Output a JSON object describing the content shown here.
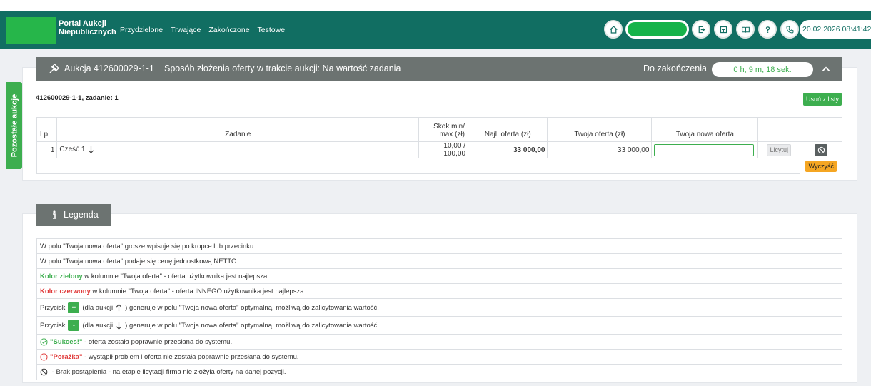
{
  "header": {
    "brand_line1": "Portal Aukcji",
    "brand_line2": "Niepublicznych",
    "nav": [
      "Przydzielone",
      "Trwające",
      "Zakończone",
      "Testowe"
    ],
    "datetime": "20.02.2026 08:41:42",
    "icons": [
      "home-icon",
      "logout-icon",
      "calculator-icon",
      "book-icon",
      "help-icon",
      "phone-icon"
    ]
  },
  "side_tab": {
    "label": "Pozostałe aukcje"
  },
  "auction": {
    "title": "Aukcja 412600029-1-1",
    "mode": "Sposób złożenia oferty w trakcie aukcji: Na wartość zadania",
    "remaining_label": "Do zakończenia",
    "timer": "0 h, 9 m, 18 sek.",
    "subtitle": "412600029-1-1, zadanie: 1",
    "remove_label": "Usuń z listy",
    "columns": {
      "lp": "Lp.",
      "task": "Zadanie",
      "step_line1": "Skok min/",
      "step_line2": "max (zł)",
      "best": "Najl. oferta (zł)",
      "yours": "Twoja oferta (zł)",
      "new": "Twoja nowa oferta"
    },
    "row": {
      "lp": "1",
      "task": "Cześć 1",
      "step": "10,00 / 100,00",
      "best": "33 000,00",
      "yours": "33 000,00",
      "minus": "-",
      "bid_label": "Licytuj"
    },
    "clear_label": "Wyczyść"
  },
  "legend": {
    "title": "Legenda",
    "rows": {
      "r1": "W polu \"Twoja nowa oferta\" grosze wpisuje się po kropce lub przecinku.",
      "r2": "W polu \"Twoja nowa oferta\" podaje się cenę jednostkową NETTO .",
      "r3_bold": "Kolor zielony",
      "r3_rest": " w kolumnie \"Twoja oferta\" - oferta użytkownika jest najlepsza.",
      "r4_bold": "Kolor czerwony",
      "r4_rest": " w kolumnie \"Twoja oferta\" - oferta INNEGO użytkownika jest najlepsza.",
      "r5_prefix": "Przycisk",
      "r5_btn": "+",
      "r5_mid": "(dla aukcji",
      "r5_rest": ") generuje w polu \"Twoja nowa oferta\" optymalną, możliwą do zalicytowania wartość.",
      "r6_prefix": "Przycisk",
      "r6_btn": "-",
      "r6_mid": "(dla aukcji",
      "r6_rest": ") generuje w polu \"Twoja nowa oferta\" optymalną, możliwą do zalicytowania wartość.",
      "r7_bold": "\"Sukces!\"",
      "r7_rest": " - oferta została poprawnie przesłana do systemu.",
      "r8_bold": "\"Porażka\"",
      "r8_rest": " - wystąpił problem i oferta nie została poprawnie przesłana do systemu.",
      "r9_rest": " - Brak postąpienia - na etapie licytacji firma nie złożyła oferty na danej pozycji."
    }
  },
  "colors": {
    "header_bg": "#116e62",
    "accent_green": "#3dae4f",
    "panel_header": "#6c7371",
    "warning": "#f5a623",
    "danger": "#e03a3a"
  }
}
